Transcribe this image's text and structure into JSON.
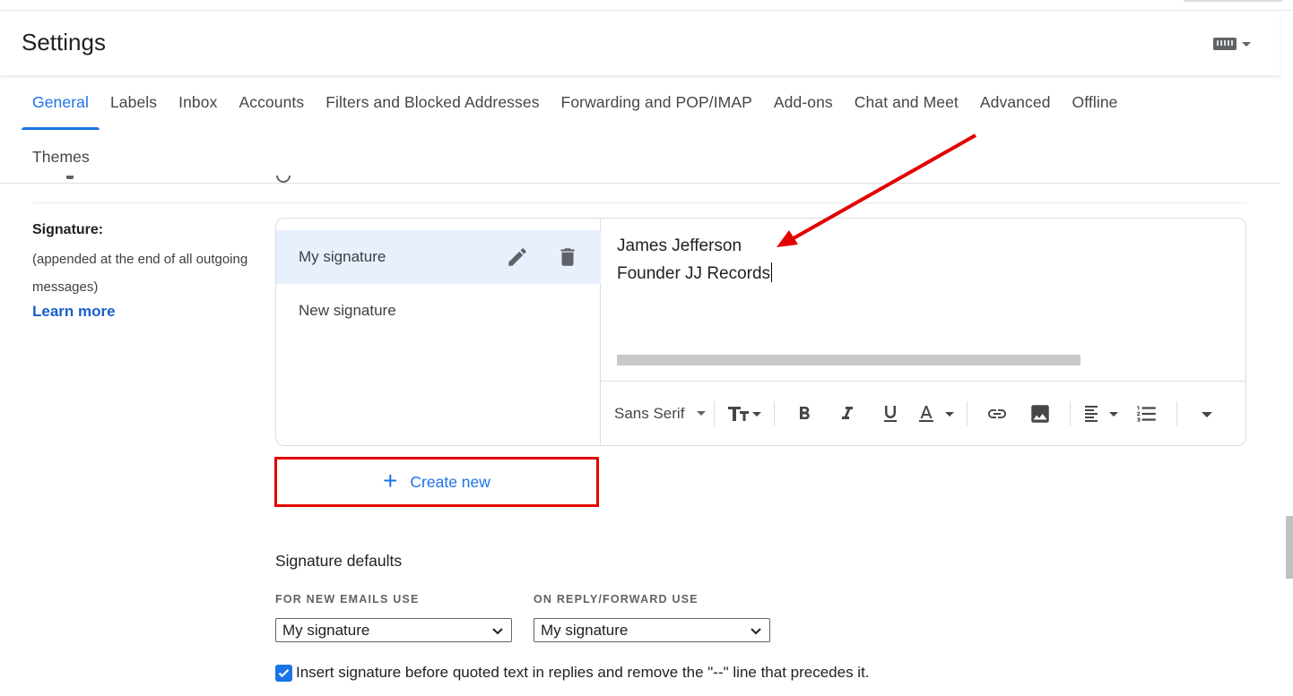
{
  "header": {
    "title": "Settings",
    "keyboard_icon": "keyboard-icon"
  },
  "tabs": {
    "row1": [
      "General",
      "Labels",
      "Inbox",
      "Accounts",
      "Filters and Blocked Addresses",
      "Forwarding and POP/IMAP",
      "Add-ons",
      "Chat and Meet",
      "Advanced",
      "Offline"
    ],
    "row2": [
      "Themes"
    ],
    "active": "General"
  },
  "signature": {
    "label": "Signature:",
    "description": "(appended at the end of all outgoing messages)",
    "learn_more": "Learn more",
    "items": [
      {
        "name": "My signature",
        "selected": true
      },
      {
        "name": "New signature",
        "selected": false
      }
    ],
    "editor_lines": [
      "James Jefferson",
      "Founder JJ Records"
    ],
    "toolbar": {
      "font": "Sans Serif"
    },
    "create_new": "Create new"
  },
  "defaults": {
    "title": "Signature defaults",
    "new_emails_label": "FOR NEW EMAILS USE",
    "new_emails_value": "My signature",
    "reply_label": "ON REPLY/FORWARD USE",
    "reply_value": "My signature",
    "insert_checked": true,
    "insert_text": "Insert signature before quoted text in replies and remove the \"--\" line that precedes it."
  },
  "colors": {
    "accent": "#1a73e8",
    "annotation": "#e30000",
    "selected_bg": "#e8f0fe"
  }
}
